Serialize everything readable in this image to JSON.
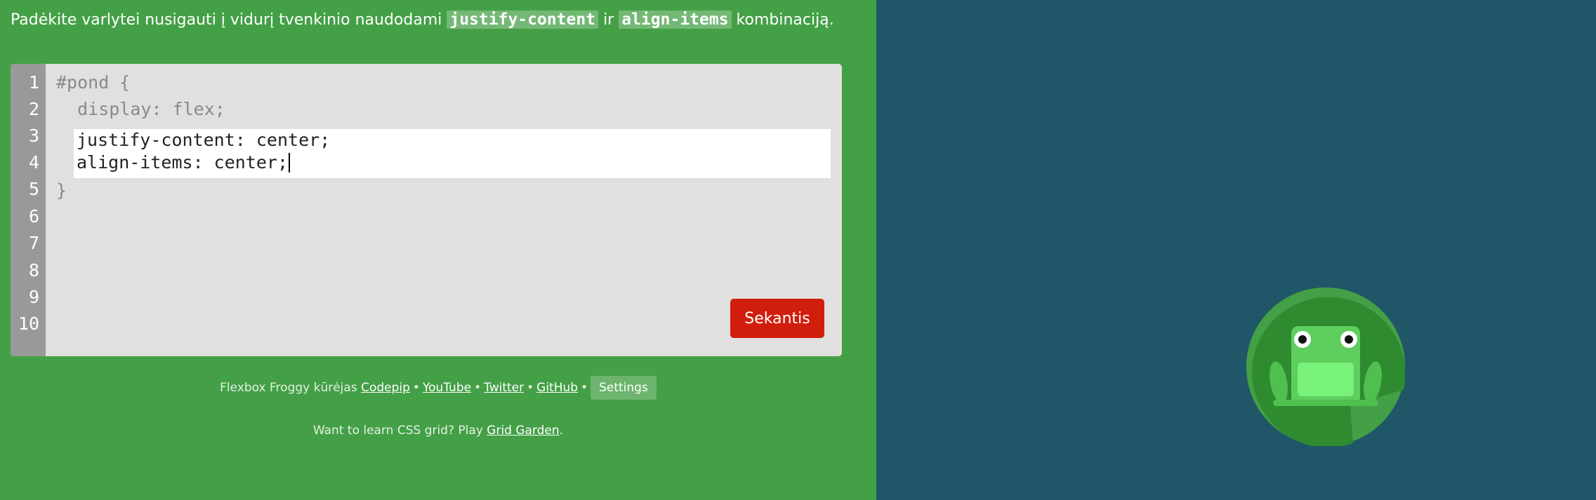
{
  "instruction": {
    "prefix": "Padėkite varlytei nusigauti į vidurį tvenkinio naudodami ",
    "code1": "justify-content",
    "middle": " ir ",
    "code2": "align-items",
    "suffix": " kombinaciją."
  },
  "editor": {
    "line_numbers": [
      "1",
      "2",
      "3",
      "4",
      "5",
      "6",
      "7",
      "8",
      "9",
      "10"
    ],
    "before_lines": [
      "#pond {",
      "  display: flex;"
    ],
    "input_lines": [
      "justify-content: center;",
      "align-items: center;"
    ],
    "after_lines": [
      "}"
    ]
  },
  "next_button_label": "Sekantis",
  "footer": {
    "credit_prefix": "Flexbox Froggy kūrėjas ",
    "links": [
      "Codepip",
      "YouTube",
      "Twitter",
      "GitHub"
    ],
    "separator": "•",
    "settings_label": "Settings"
  },
  "grid_note": {
    "prefix": "Want to learn CSS grid? Play ",
    "link": "Grid Garden",
    "suffix": "."
  },
  "colors": {
    "left_panel": "#44a047",
    "pond": "#1f5768",
    "editor_bg": "#e0e0e0",
    "gutter": "#999999",
    "next_button": "#d11e0c",
    "lilypad": "#43a047",
    "frog": "#5ece5e"
  },
  "icons": {
    "frog": "frog-icon",
    "lilypad": "lilypad-icon"
  }
}
